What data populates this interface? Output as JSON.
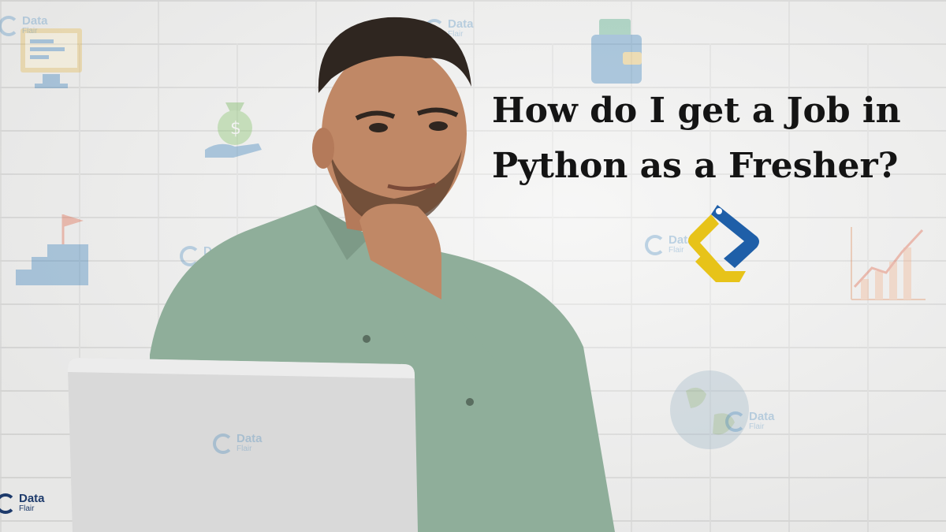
{
  "headline": {
    "line1": "How do I get a Job in",
    "line2": "Python as a Fresher?"
  },
  "watermark": {
    "brand": "Data",
    "sub": "Flair"
  },
  "colors": {
    "wall": "#f0f0ef",
    "headline_text": "#141414",
    "shirt": "#8fae9a",
    "laptop": "#d9d9d9",
    "logo_blue": "#1f5fa8",
    "logo_yellow": "#e7c319",
    "watermark_blue": "#2c79b8"
  },
  "icons": [
    "laptop-code-icon",
    "money-bag-icon",
    "wallet-icon",
    "stairs-flag-icon",
    "growth-chart-icon",
    "globe-icon",
    "python-logo-icon"
  ]
}
